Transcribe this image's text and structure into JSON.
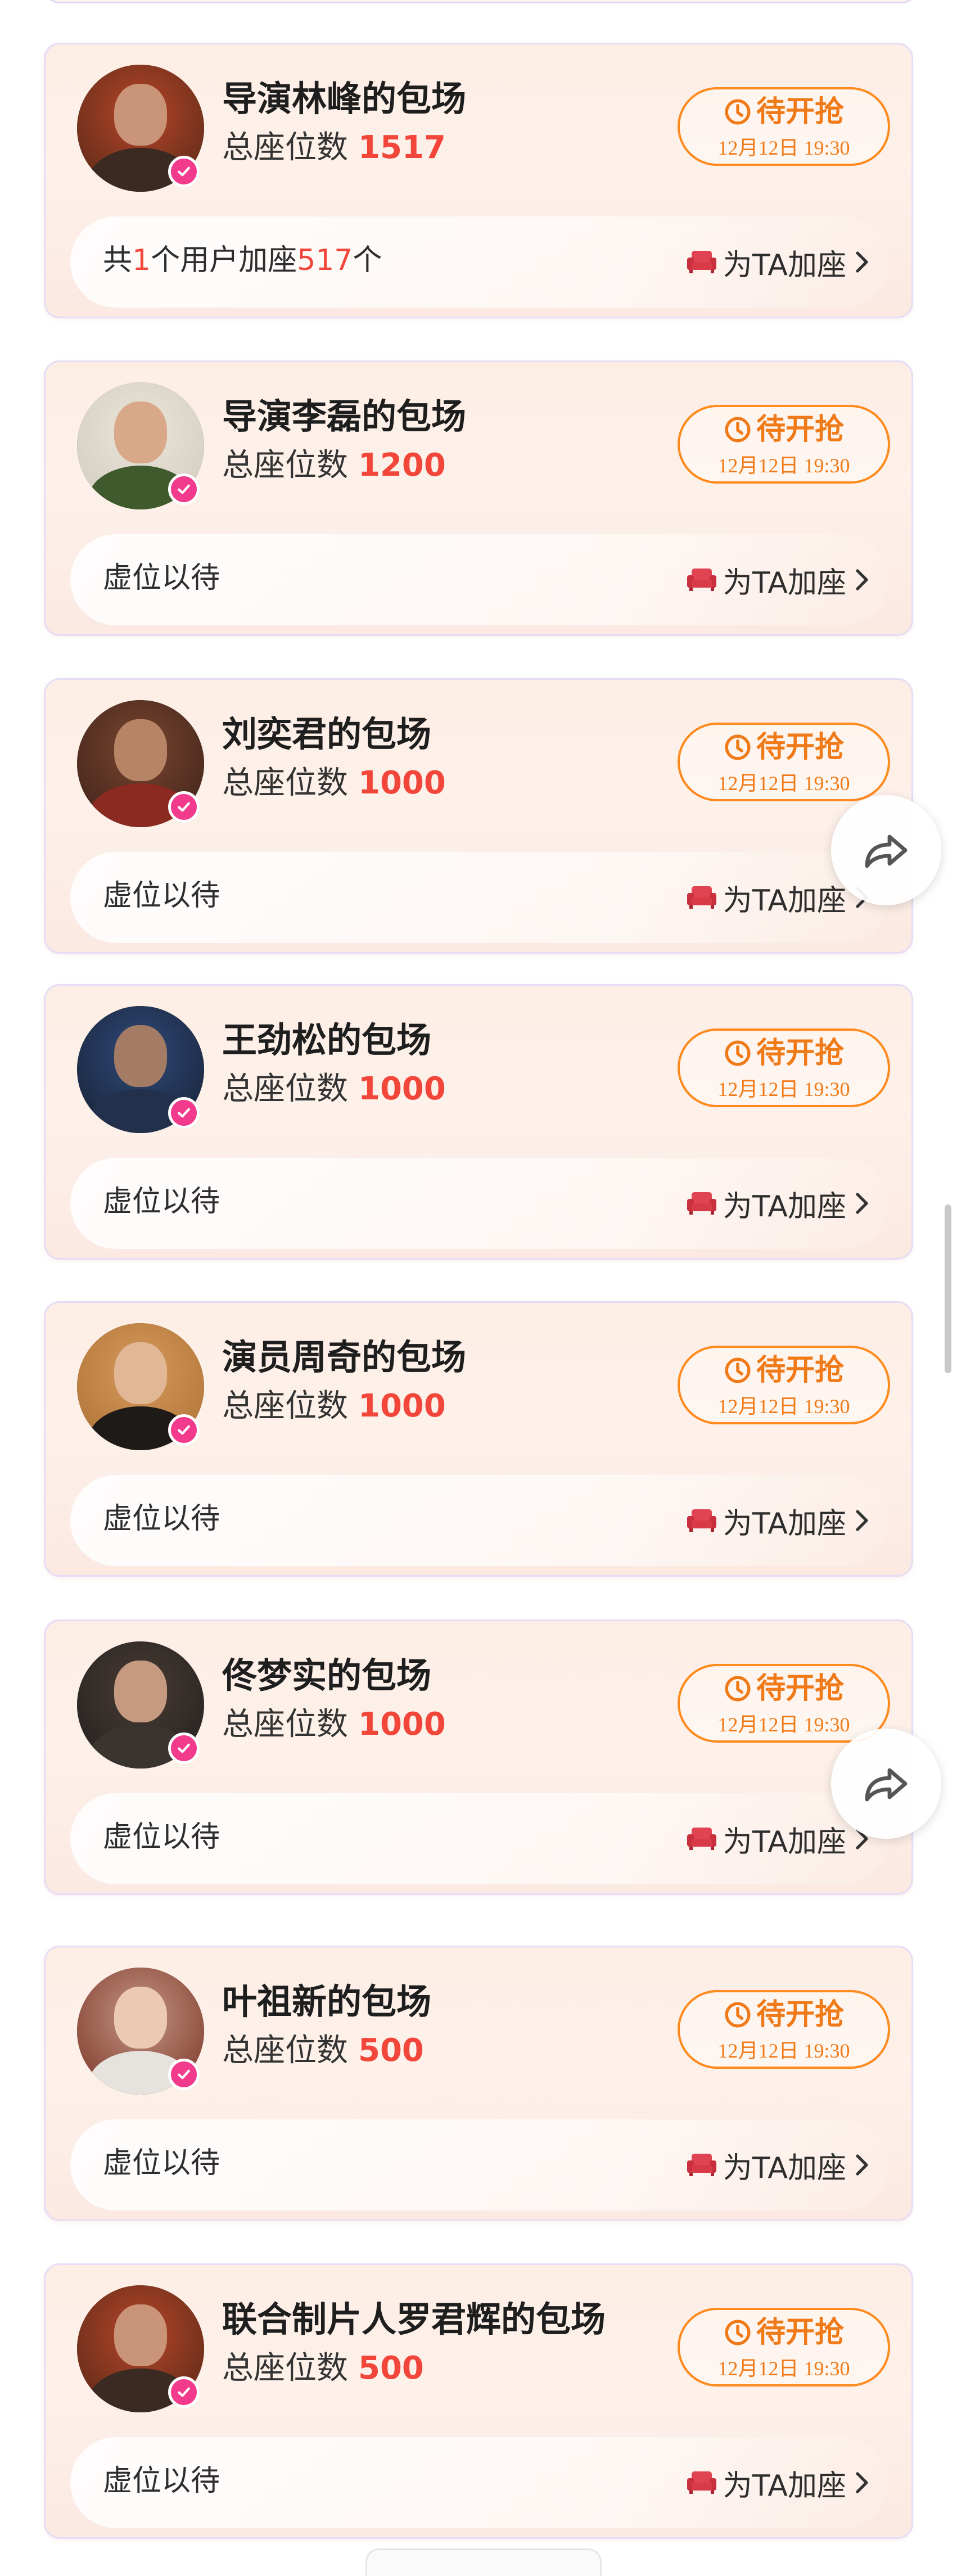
{
  "theme": {
    "accent_orange": "#ff8a1e",
    "seat_count_red": "#f2463a",
    "verified_badge_pink": "#f23b8c",
    "card_border": "#e6dcf5",
    "card_background": "#fdeee5"
  },
  "icons": {
    "pending": "clock-icon",
    "add_seat": "sofa-icon",
    "arrow": "chevron-right-icon",
    "badge": "verified-check-icon",
    "share": "share-arrow-icon"
  },
  "cards": [
    {
      "title": "导演林峰的包场",
      "seat_label": "总座位数",
      "seat_count": "1517",
      "pending_label": "待开抢",
      "pending_time": "12月12日 19:30",
      "info_parts": [
        "共",
        "1",
        "个用户加座",
        "517",
        "个"
      ],
      "add_label": "为TA加座",
      "avatar": {
        "bg": "#6b2f1a",
        "glow": "#b8452a",
        "skin": "#c99478",
        "cloth": "#3a2a22"
      }
    },
    {
      "title": "导演李磊的包场",
      "seat_label": "总座位数",
      "seat_count": "1200",
      "pending_label": "待开抢",
      "pending_time": "12月12日 19:30",
      "info_parts": [
        "虚位以待"
      ],
      "add_label": "为TA加座",
      "avatar": {
        "bg": "#d7d0c4",
        "glow": "#ebe5da",
        "skin": "#d8a888",
        "cloth": "#3f5a2c"
      }
    },
    {
      "title": "刘奕君的包场",
      "seat_label": "总座位数",
      "seat_count": "1000",
      "pending_label": "待开抢",
      "pending_time": "12月12日 19:30",
      "info_parts": [
        "虚位以待"
      ],
      "add_label": "为TA加座",
      "avatar": {
        "bg": "#4a2a1e",
        "glow": "#7a4530",
        "skin": "#b88466",
        "cloth": "#8a2a20"
      }
    },
    {
      "title": "王劲松的包场",
      "seat_label": "总座位数",
      "seat_count": "1000",
      "pending_label": "待开抢",
      "pending_time": "12月12日 19:30",
      "info_parts": [
        "虚位以待"
      ],
      "add_label": "为TA加座",
      "avatar": {
        "bg": "#1c2a44",
        "glow": "#2f4a78",
        "skin": "#a47c66",
        "cloth": "#22304c"
      }
    },
    {
      "title": "演员周奇的包场",
      "seat_label": "总座位数",
      "seat_count": "1000",
      "pending_label": "待开抢",
      "pending_time": "12月12日 19:30",
      "info_parts": [
        "虚位以待"
      ],
      "add_label": "为TA加座",
      "avatar": {
        "bg": "#b77a3e",
        "glow": "#d49a5a",
        "skin": "#e2b795",
        "cloth": "#1e1a18"
      }
    },
    {
      "title": "佟梦实的包场",
      "seat_label": "总座位数",
      "seat_count": "1000",
      "pending_label": "待开抢",
      "pending_time": "12月12日 19:30",
      "info_parts": [
        "虚位以待"
      ],
      "add_label": "为TA加座",
      "avatar": {
        "bg": "#2a2624",
        "glow": "#4a3c34",
        "skin": "#c69a80",
        "cloth": "#3a3430"
      }
    },
    {
      "title": "叶祖新的包场",
      "seat_label": "总座位数",
      "seat_count": "500",
      "pending_label": "待开抢",
      "pending_time": "12月12日 19:30",
      "info_parts": [
        "虚位以待"
      ],
      "add_label": "为TA加座",
      "avatar": {
        "bg": "#8a4a3a",
        "glow": "#c49484",
        "skin": "#ecc9b4",
        "cloth": "#e6e2de"
      }
    },
    {
      "title": "联合制片人罗君辉的包场",
      "seat_label": "总座位数",
      "seat_count": "500",
      "pending_label": "待开抢",
      "pending_time": "12月12日 19:30",
      "info_parts": [
        "虚位以待"
      ],
      "add_label": "为TA加座",
      "avatar": {
        "bg": "#6b2f1a",
        "glow": "#b8452a",
        "skin": "#c99478",
        "cloth": "#3a2a22"
      }
    }
  ]
}
